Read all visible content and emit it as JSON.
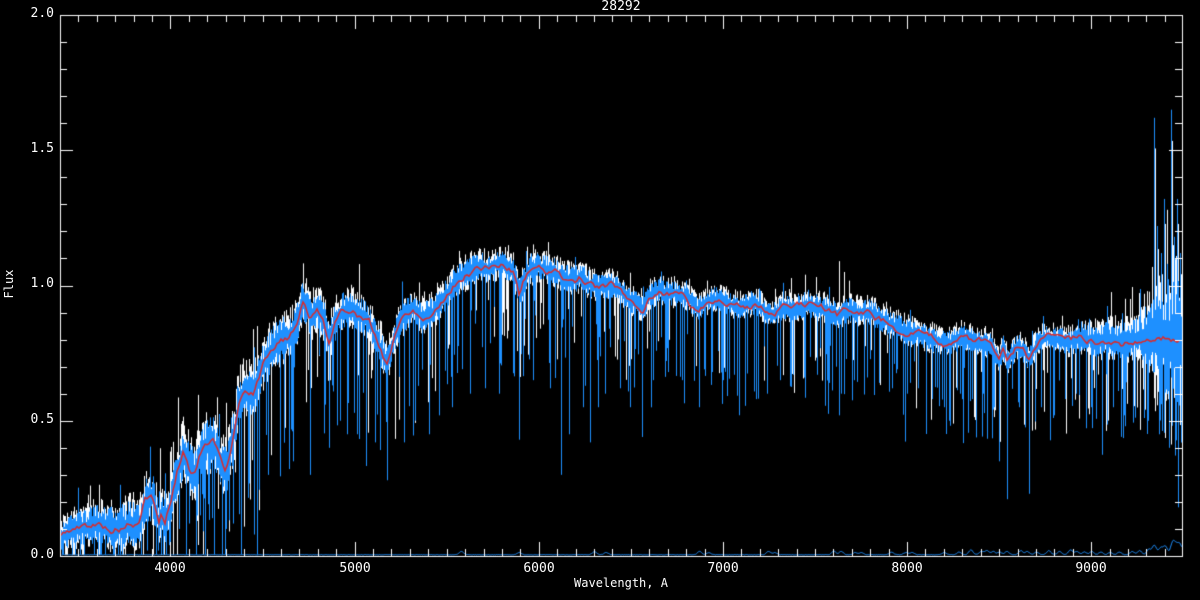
{
  "title": "28292",
  "colors": {
    "background": "#000000",
    "axis": "#ffffff",
    "observed_spectrum": "#ffffff",
    "smoothed_spectrum": "#1e90ff",
    "model_fit": "#dc2a2a"
  },
  "chart_data": {
    "type": "line",
    "title": "28292",
    "xlabel": "Wavelength, A",
    "ylabel": "Flux",
    "xlim": [
      3400,
      9493
    ],
    "ylim": [
      0.0,
      2.0
    ],
    "grid": false,
    "legend": "none",
    "x_tick_values": [
      4000,
      5000,
      6000,
      7000,
      8000,
      9000
    ],
    "x_tick_labels": [
      "4000",
      "5000",
      "6000",
      "7000",
      "8000",
      "9000"
    ],
    "x_minor_tick_interval": 100,
    "y_tick_values": [
      0.0,
      0.5,
      1.0,
      1.5,
      2.0
    ],
    "y_tick_labels": [
      "0.0",
      "0.5",
      "1.0",
      "1.5",
      "2.0"
    ],
    "y_minor_tick_interval": 0.1,
    "series": [
      {
        "name": "observed-spectrum",
        "color": "#ffffff",
        "style": "noisy-band"
      },
      {
        "name": "smoothed-spectrum",
        "color": "#1e90ff",
        "style": "noisy-band"
      },
      {
        "name": "model-fit",
        "color": "#dc2a2a",
        "style": "smooth-line"
      },
      {
        "name": "error-spectrum",
        "color": "#1e90ff",
        "style": "baseline",
        "base_level": 0.004
      }
    ],
    "model_points": [
      [
        3400,
        0.07
      ],
      [
        3450,
        0.095
      ],
      [
        3500,
        0.1
      ],
      [
        3560,
        0.11
      ],
      [
        3620,
        0.115
      ],
      [
        3680,
        0.1
      ],
      [
        3730,
        0.105
      ],
      [
        3780,
        0.12
      ],
      [
        3830,
        0.11
      ],
      [
        3860,
        0.2
      ],
      [
        3900,
        0.22
      ],
      [
        3935,
        0.12
      ],
      [
        3950,
        0.15
      ],
      [
        3970,
        0.12
      ],
      [
        4000,
        0.2
      ],
      [
        4040,
        0.32
      ],
      [
        4070,
        0.39
      ],
      [
        4100,
        0.33
      ],
      [
        4130,
        0.31
      ],
      [
        4170,
        0.4
      ],
      [
        4230,
        0.42
      ],
      [
        4270,
        0.35
      ],
      [
        4300,
        0.31
      ],
      [
        4340,
        0.44
      ],
      [
        4370,
        0.58
      ],
      [
        4410,
        0.62
      ],
      [
        4450,
        0.6
      ],
      [
        4500,
        0.7
      ],
      [
        4550,
        0.77
      ],
      [
        4600,
        0.8
      ],
      [
        4640,
        0.81
      ],
      [
        4680,
        0.85
      ],
      [
        4720,
        0.95
      ],
      [
        4760,
        0.88
      ],
      [
        4800,
        0.91
      ],
      [
        4830,
        0.87
      ],
      [
        4861,
        0.8
      ],
      [
        4890,
        0.86
      ],
      [
        4930,
        0.9
      ],
      [
        4980,
        0.92
      ],
      [
        5030,
        0.89
      ],
      [
        5080,
        0.86
      ],
      [
        5130,
        0.78
      ],
      [
        5175,
        0.71
      ],
      [
        5210,
        0.8
      ],
      [
        5260,
        0.88
      ],
      [
        5320,
        0.92
      ],
      [
        5370,
        0.88
      ],
      [
        5420,
        0.9
      ],
      [
        5470,
        0.94
      ],
      [
        5520,
        0.99
      ],
      [
        5570,
        1.03
      ],
      [
        5620,
        1.05
      ],
      [
        5670,
        1.07
      ],
      [
        5720,
        1.06
      ],
      [
        5770,
        1.08
      ],
      [
        5820,
        1.07
      ],
      [
        5860,
        1.05
      ],
      [
        5893,
        0.97
      ],
      [
        5930,
        1.04
      ],
      [
        5980,
        1.07
      ],
      [
        6030,
        1.06
      ],
      [
        6080,
        1.05
      ],
      [
        6130,
        1.03
      ],
      [
        6180,
        1.02
      ],
      [
        6230,
        1.03
      ],
      [
        6280,
        1.0
      ],
      [
        6330,
        0.99
      ],
      [
        6380,
        1.0
      ],
      [
        6430,
        0.99
      ],
      [
        6480,
        0.95
      ],
      [
        6530,
        0.93
      ],
      [
        6563,
        0.91
      ],
      [
        6600,
        0.96
      ],
      [
        6650,
        0.98
      ],
      [
        6700,
        0.97
      ],
      [
        6750,
        0.97
      ],
      [
        6800,
        0.96
      ],
      [
        6860,
        0.91
      ],
      [
        6920,
        0.945
      ],
      [
        6980,
        0.95
      ],
      [
        7040,
        0.93
      ],
      [
        7100,
        0.92
      ],
      [
        7160,
        0.935
      ],
      [
        7220,
        0.91
      ],
      [
        7270,
        0.895
      ],
      [
        7330,
        0.92
      ],
      [
        7390,
        0.915
      ],
      [
        7450,
        0.93
      ],
      [
        7510,
        0.92
      ],
      [
        7570,
        0.91
      ],
      [
        7620,
        0.89
      ],
      [
        7680,
        0.91
      ],
      [
        7740,
        0.9
      ],
      [
        7800,
        0.9
      ],
      [
        7850,
        0.88
      ],
      [
        7900,
        0.86
      ],
      [
        7950,
        0.845
      ],
      [
        8000,
        0.83
      ],
      [
        8060,
        0.82
      ],
      [
        8120,
        0.805
      ],
      [
        8180,
        0.79
      ],
      [
        8230,
        0.785
      ],
      [
        8290,
        0.81
      ],
      [
        8350,
        0.8
      ],
      [
        8400,
        0.79
      ],
      [
        8450,
        0.785
      ],
      [
        8498,
        0.72
      ],
      [
        8520,
        0.77
      ],
      [
        8545,
        0.72
      ],
      [
        8600,
        0.78
      ],
      [
        8662,
        0.73
      ],
      [
        8710,
        0.79
      ],
      [
        8760,
        0.81
      ],
      [
        8810,
        0.8
      ],
      [
        8860,
        0.79
      ],
      [
        8920,
        0.8
      ],
      [
        8980,
        0.8
      ],
      [
        9040,
        0.795
      ],
      [
        9100,
        0.8
      ],
      [
        9160,
        0.79
      ],
      [
        9220,
        0.8
      ],
      [
        9280,
        0.81
      ],
      [
        9340,
        0.8
      ],
      [
        9400,
        0.81
      ],
      [
        9460,
        0.8
      ],
      [
        9493,
        0.81
      ]
    ],
    "noise_envelope": [
      [
        3400,
        0.06
      ],
      [
        3800,
        0.09
      ],
      [
        4200,
        0.1
      ],
      [
        4700,
        0.08
      ],
      [
        5300,
        0.06
      ],
      [
        6300,
        0.05
      ],
      [
        7000,
        0.045
      ],
      [
        7800,
        0.05
      ],
      [
        8800,
        0.045
      ],
      [
        9250,
        0.08
      ],
      [
        9400,
        0.22
      ],
      [
        9493,
        0.3
      ]
    ],
    "absorption_spikes": [
      [
        3870,
        0.02
      ],
      [
        3933,
        0.02
      ],
      [
        3990,
        0.04
      ],
      [
        4045,
        0.1
      ],
      [
        4101,
        0.12
      ],
      [
        4144,
        0.15
      ],
      [
        4226,
        0.14
      ],
      [
        4300,
        0.1
      ],
      [
        4340,
        0.12
      ],
      [
        4383,
        0.18
      ],
      [
        4455,
        0.22
      ],
      [
        4530,
        0.3
      ],
      [
        4668,
        0.35
      ],
      [
        4755,
        0.3
      ],
      [
        4861,
        0.4
      ],
      [
        4920,
        0.5
      ],
      [
        4957,
        0.45
      ],
      [
        5015,
        0.45
      ],
      [
        5110,
        0.42
      ],
      [
        5175,
        0.28
      ],
      [
        5270,
        0.42
      ],
      [
        5330,
        0.5
      ],
      [
        5405,
        0.45
      ],
      [
        5460,
        0.52
      ],
      [
        5530,
        0.55
      ],
      [
        5625,
        0.6
      ],
      [
        5710,
        0.62
      ],
      [
        5782,
        0.6
      ],
      [
        5893,
        0.43
      ],
      [
        5970,
        0.65
      ],
      [
        6060,
        0.62
      ],
      [
        6122,
        0.3
      ],
      [
        6162,
        0.45
      ],
      [
        6240,
        0.55
      ],
      [
        6280,
        0.42
      ],
      [
        6320,
        0.55
      ],
      [
        6360,
        0.6
      ],
      [
        6440,
        0.62
      ],
      [
        6495,
        0.55
      ],
      [
        6563,
        0.44
      ],
      [
        6620,
        0.65
      ],
      [
        6700,
        0.68
      ],
      [
        6780,
        0.65
      ],
      [
        6870,
        0.55
      ],
      [
        6940,
        0.68
      ],
      [
        7000,
        0.65
      ],
      [
        7060,
        0.67
      ],
      [
        7120,
        0.63
      ],
      [
        7180,
        0.58
      ],
      [
        7240,
        0.6
      ],
      [
        7310,
        0.65
      ],
      [
        7380,
        0.67
      ],
      [
        7440,
        0.66
      ],
      [
        7510,
        0.67
      ],
      [
        7575,
        0.64
      ],
      [
        7640,
        0.6
      ],
      [
        7710,
        0.65
      ],
      [
        7780,
        0.66
      ],
      [
        7850,
        0.64
      ],
      [
        7920,
        0.62
      ],
      [
        8000,
        0.6
      ],
      [
        8060,
        0.62
      ],
      [
        8135,
        0.58
      ],
      [
        8200,
        0.55
      ],
      [
        8230,
        0.5
      ],
      [
        8290,
        0.6
      ],
      [
        8350,
        0.58
      ],
      [
        8410,
        0.6
      ],
      [
        8470,
        0.55
      ],
      [
        8498,
        0.35
      ],
      [
        8545,
        0.21
      ],
      [
        8610,
        0.55
      ],
      [
        8662,
        0.23
      ],
      [
        8730,
        0.55
      ],
      [
        8796,
        0.52
      ],
      [
        8860,
        0.58
      ],
      [
        8920,
        0.6
      ],
      [
        9000,
        0.55
      ],
      [
        9060,
        0.5
      ],
      [
        9120,
        0.55
      ],
      [
        9180,
        0.52
      ],
      [
        9240,
        0.55
      ],
      [
        9310,
        0.5
      ],
      [
        9370,
        0.45
      ],
      [
        9420,
        0.4
      ],
      [
        9472,
        0.18
      ]
    ],
    "emission_spikes": [
      [
        9340,
        1.62
      ],
      [
        9357,
        1.22
      ],
      [
        9378,
        1.12
      ],
      [
        9395,
        1.32
      ],
      [
        9413,
        1.08
      ],
      [
        9432,
        1.65
      ],
      [
        9448,
        1.18
      ],
      [
        9465,
        1.32
      ],
      [
        9480,
        1.12
      ]
    ],
    "white_up_spikes": [
      [
        7448,
        1.04
      ],
      [
        7630,
        1.09
      ],
      [
        7655,
        1.05
      ]
    ],
    "error_bumps": [
      [
        5577,
        0.012
      ],
      [
        5890,
        0.008
      ],
      [
        6300,
        0.011
      ],
      [
        6363,
        0.008
      ],
      [
        6870,
        0.012
      ],
      [
        6920,
        0.008
      ],
      [
        7245,
        0.012
      ],
      [
        7280,
        0.008
      ],
      [
        7600,
        0.013
      ],
      [
        7640,
        0.012
      ],
      [
        7715,
        0.008
      ],
      [
        7750,
        0.008
      ],
      [
        7913,
        0.01
      ],
      [
        7990,
        0.008
      ],
      [
        8025,
        0.008
      ],
      [
        8200,
        0.008
      ],
      [
        8280,
        0.01
      ],
      [
        8344,
        0.018
      ],
      [
        8400,
        0.012
      ],
      [
        8430,
        0.015
      ],
      [
        8465,
        0.012
      ],
      [
        8500,
        0.01
      ],
      [
        8540,
        0.012
      ],
      [
        8615,
        0.015
      ],
      [
        8650,
        0.012
      ],
      [
        8700,
        0.01
      ],
      [
        8767,
        0.015
      ],
      [
        8825,
        0.012
      ],
      [
        8885,
        0.018
      ],
      [
        8920,
        0.012
      ],
      [
        8960,
        0.01
      ],
      [
        9000,
        0.012
      ],
      [
        9050,
        0.01
      ],
      [
        9100,
        0.008
      ],
      [
        9150,
        0.01
      ],
      [
        9220,
        0.012
      ],
      [
        9260,
        0.015
      ],
      [
        9310,
        0.02
      ],
      [
        9340,
        0.035
      ],
      [
        9375,
        0.025
      ],
      [
        9400,
        0.03
      ],
      [
        9440,
        0.045
      ],
      [
        9460,
        0.03
      ],
      [
        9480,
        0.035
      ]
    ]
  }
}
